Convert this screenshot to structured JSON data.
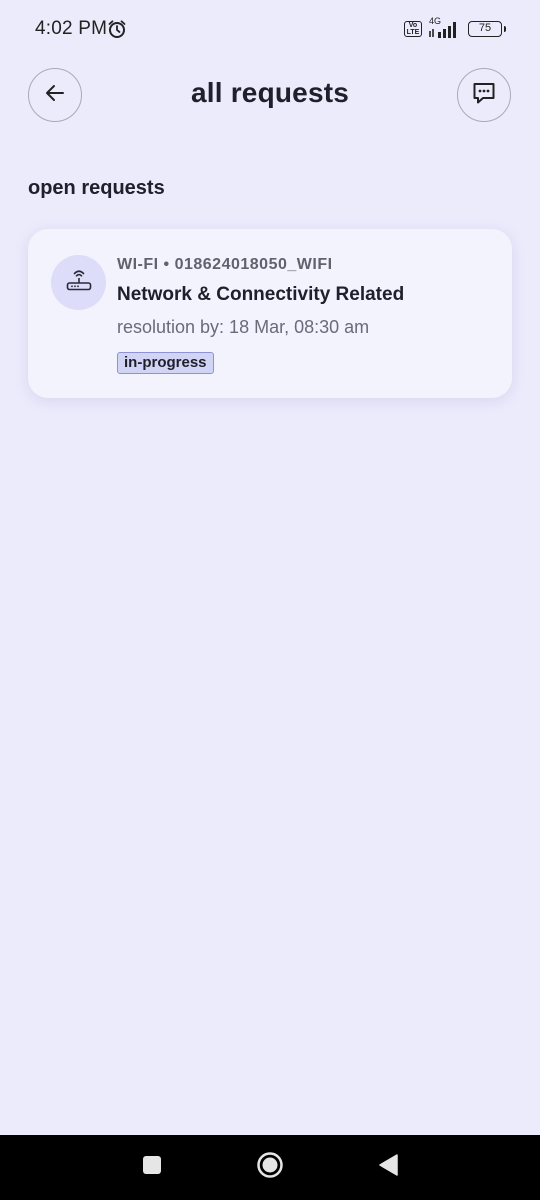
{
  "status_bar": {
    "time": "4:02 PM",
    "network_type": "4G",
    "volte_label": "Vo LTE",
    "battery_level": "75"
  },
  "header": {
    "title": "all requests",
    "back_icon": "arrow-left-icon",
    "chat_icon": "chat-bubble-icon"
  },
  "open_requests": {
    "section_title": "open requests",
    "items": [
      {
        "icon": "router-icon",
        "meta": "WI-FI • 018624018050_WIFI",
        "title": "Network & Connectivity Related",
        "resolution": "resolution by: 18 Mar, 08:30 am",
        "status": "in-progress"
      }
    ]
  },
  "colors": {
    "background": "#ECEBFC",
    "card": "#F3F3FE",
    "badge_bg": "#D2D4F6",
    "badge_border": "#8F93D6",
    "icon_circle": "#DDDCF9"
  }
}
